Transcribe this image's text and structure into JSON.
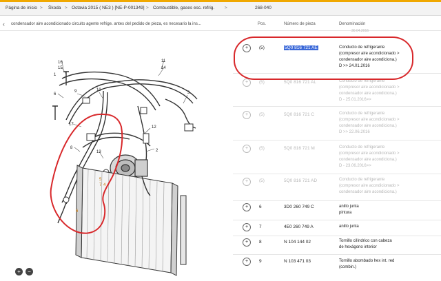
{
  "breadcrumb": [
    "Página de inicio",
    "Škoda",
    "Octavia 2015 ( NE3 ) [NE-P-001349]",
    "Combustible, gases esc. refrig.",
    "268-040"
  ],
  "subheader": {
    "text": "condensador aire acondicionado circuito agente refrige. antes del pedido de pieza, es necesario la ins..."
  },
  "columns": {
    "pos": "Pos.",
    "part": "Número de pieza",
    "desc": "Denominación"
  },
  "partial_top_desc": "30.04.2016",
  "diagram_callouts": [
    "16",
    "15",
    "1",
    "11",
    "14",
    "9",
    "6",
    "10",
    "17",
    "8",
    "13",
    "12",
    "5",
    "4",
    "7",
    "3",
    "2"
  ],
  "rows": [
    {
      "pos": "(5)",
      "part": "5Q0 816 721 AE",
      "desc": [
        "Conducto de refrigerante",
        "(compresor aire acondicionado >",
        "condensador aire acondiciona.)",
        "D  >> 24.01.2016"
      ],
      "active": true,
      "selected": true
    },
    {
      "pos": "(5)",
      "part": "5Q0 816 721 AL",
      "desc": [
        "Conducto de refrigerante",
        "(compresor aire acondicionado >",
        "condensador aire acondiciona.)",
        "D - 25.01.2016>>"
      ],
      "active": false
    },
    {
      "pos": "(5)",
      "part": "5Q0 816 721 C",
      "desc": [
        "Conducto de refrigerante",
        "(compresor aire acondicionado >",
        "condensador aire acondiciona.)",
        "D  >> 22.06.2016"
      ],
      "active": false
    },
    {
      "pos": "(5)",
      "part": "5Q0 816 721 M",
      "desc": [
        "Conducto de refrigerante",
        "(compresor aire acondicionado >",
        "condensador aire acondiciona.)",
        "D - 23.06.2016>>"
      ],
      "active": false
    },
    {
      "pos": "(5)",
      "part": "5Q0 816 721 AD",
      "desc": [
        "Conducto de refrigerante",
        "(compresor aire acondicionado >",
        "condensador aire acondiciona.)"
      ],
      "active": false
    },
    {
      "pos": "6",
      "part": "3D0 260 749 C",
      "desc": [
        "anillo junta",
        "pintura"
      ],
      "active": true
    },
    {
      "pos": "7",
      "part": "4E0 260 749 A",
      "desc": [
        "anillo junta"
      ],
      "active": true
    },
    {
      "pos": "8",
      "part": "N  104 144 02",
      "desc": [
        "Tornillo cilíndrico con cabeza",
        "de hexágono interior"
      ],
      "active": true
    },
    {
      "pos": "9",
      "part": "N  103 471 03",
      "desc": [
        "Tornillo abombado hex int. red",
        "(combin.)"
      ],
      "active": true
    }
  ],
  "icons": {
    "add": "add-to-cart-icon",
    "zoom_in": "zoom-in-icon",
    "zoom_out": "zoom-out-icon"
  },
  "colors": {
    "accent": "#f0a800",
    "highlight_oval": "#d8282b",
    "selection": "#3a68d8"
  }
}
